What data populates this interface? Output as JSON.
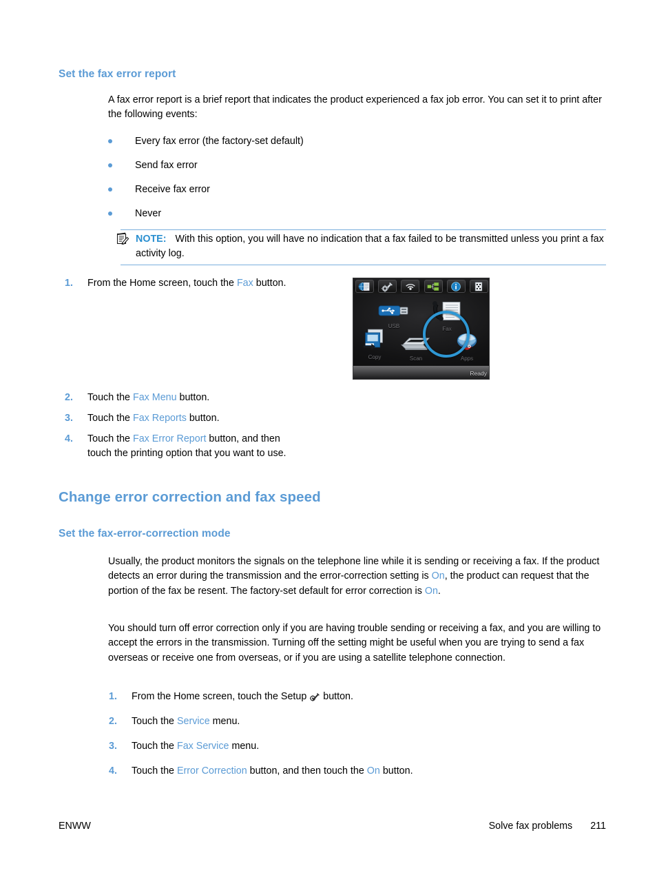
{
  "colors": {
    "heading_blue": "#5b9bd5",
    "link_blue": "#5b9bd5",
    "note_label_blue": "#2a8fd0",
    "note_rule": "#7aaedd",
    "highlight_ring": "#2e97d4"
  },
  "section1": {
    "heading": "Set the fax error report",
    "intro": "A fax error report is a brief report that indicates the product experienced a fax job error. You can set it to print after the following events:",
    "bullets": [
      "Every fax error (the factory-set default)",
      "Send fax error",
      "Receive fax error",
      "Never"
    ],
    "note": {
      "icon": "note-pencil-icon",
      "label": "NOTE:",
      "text": "With this option, you will have no indication that a fax failed to be transmitted unless you print a fax activity log."
    },
    "steps": [
      {
        "num": "1.",
        "parts": [
          {
            "t": "From the Home screen, touch the ",
            "style": "plain"
          },
          {
            "t": "Fax",
            "style": "link"
          },
          {
            "t": " button.",
            "style": "plain"
          }
        ]
      },
      {
        "num": "2.",
        "parts": [
          {
            "t": "Touch the ",
            "style": "plain"
          },
          {
            "t": "Fax Menu",
            "style": "link"
          },
          {
            "t": " button.",
            "style": "plain"
          }
        ]
      },
      {
        "num": "3.",
        "parts": [
          {
            "t": "Touch the ",
            "style": "plain"
          },
          {
            "t": "Fax Reports",
            "style": "link"
          },
          {
            "t": " button.",
            "style": "plain"
          }
        ]
      },
      {
        "num": "4.",
        "parts": [
          {
            "t": "Touch the ",
            "style": "plain"
          },
          {
            "t": "Fax Error Report",
            "style": "link"
          },
          {
            "t": " button, and then touch the printing option that you want to use.",
            "style": "plain"
          }
        ]
      }
    ]
  },
  "control_panel": {
    "name": "printer-home-screen",
    "status_text": "Ready",
    "top_icons": [
      "web-services-icon",
      "setup-wrench-gear-icon",
      "wireless-signal-icon",
      "network-icon",
      "information-icon",
      "supplies-icon"
    ],
    "tiles": [
      {
        "label": "USB",
        "icon": "usb-drive-icon",
        "highlighted": false
      },
      {
        "label": "Fax",
        "icon": "fax-icon",
        "highlighted": true
      },
      {
        "label": "Copy",
        "icon": "copy-icon",
        "highlighted": false
      },
      {
        "label": "Scan",
        "icon": "scanner-icon",
        "highlighted": false
      },
      {
        "label": "Apps",
        "icon": "apps-cloud-icon",
        "highlighted": false
      }
    ]
  },
  "section2": {
    "heading": "Change error correction and fax speed",
    "subheading": "Set the fax-error-correction mode",
    "para1_parts": [
      {
        "t": "Usually, the product monitors the signals on the telephone line while it is sending or receiving a fax. If the product detects an error during the transmission and the error-correction setting is ",
        "style": "plain"
      },
      {
        "t": "On",
        "style": "link"
      },
      {
        "t": ", the product can request that the portion of the fax be resent. The factory-set default for error correction is ",
        "style": "plain"
      },
      {
        "t": "On",
        "style": "link"
      },
      {
        "t": ".",
        "style": "plain"
      }
    ],
    "para2": "You should turn off error correction only if you are having trouble sending or receiving a fax, and you are willing to accept the errors in the transmission. Turning off the setting might be useful when you are trying to send a fax overseas or receive one from overseas, or if you are using a satellite telephone connection.",
    "steps": [
      {
        "num": "1.",
        "parts": [
          {
            "t": "From the Home screen, touch the Setup ",
            "style": "plain"
          },
          {
            "t": "",
            "style": "gear-icon"
          },
          {
            "t": " button.",
            "style": "plain"
          }
        ]
      },
      {
        "num": "2.",
        "parts": [
          {
            "t": "Touch the ",
            "style": "plain"
          },
          {
            "t": "Service",
            "style": "link"
          },
          {
            "t": " menu.",
            "style": "plain"
          }
        ]
      },
      {
        "num": "3.",
        "parts": [
          {
            "t": "Touch the ",
            "style": "plain"
          },
          {
            "t": "Fax Service",
            "style": "link"
          },
          {
            "t": " menu.",
            "style": "plain"
          }
        ]
      },
      {
        "num": "4.",
        "parts": [
          {
            "t": "Touch the ",
            "style": "plain"
          },
          {
            "t": "Error Correction",
            "style": "link"
          },
          {
            "t": " button, and then touch the ",
            "style": "plain"
          },
          {
            "t": "On",
            "style": "link"
          },
          {
            "t": " button.",
            "style": "plain"
          }
        ]
      }
    ]
  },
  "footer": {
    "left": "ENWW",
    "chapter": "Solve fax problems",
    "page_number": "211"
  }
}
